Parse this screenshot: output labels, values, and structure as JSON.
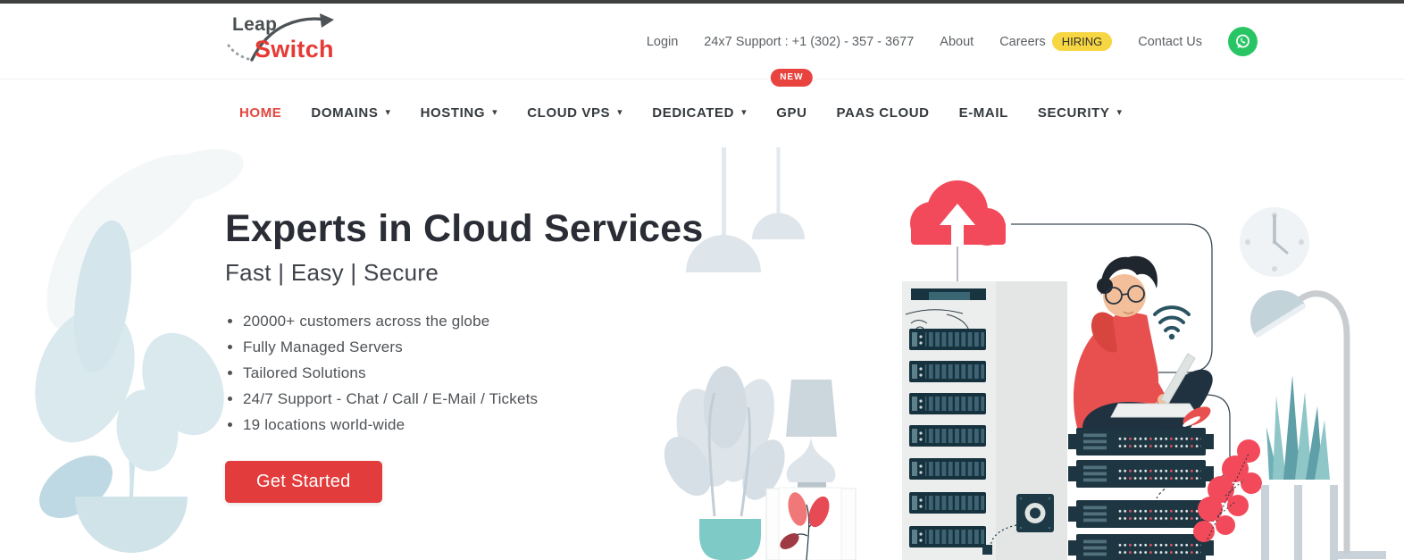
{
  "brand": {
    "line1": "Leap",
    "line2": "Switch"
  },
  "topbar": {
    "login": "Login",
    "support": "24x7 Support : +1 (302) - 357 - 3677",
    "about": "About",
    "careers": "Careers",
    "hiring_badge": "HIRING",
    "contact": "Contact Us"
  },
  "nav": {
    "new_badge": "NEW",
    "items": [
      {
        "label": "HOME",
        "active": true,
        "dropdown": false
      },
      {
        "label": "DOMAINS",
        "dropdown": true
      },
      {
        "label": "HOSTING",
        "dropdown": true
      },
      {
        "label": "CLOUD VPS",
        "dropdown": true
      },
      {
        "label": "DEDICATED",
        "dropdown": true
      },
      {
        "label": "GPU",
        "dropdown": false,
        "badge": "NEW"
      },
      {
        "label": "PAAS CLOUD",
        "dropdown": false
      },
      {
        "label": "E-MAIL",
        "dropdown": false
      },
      {
        "label": "SECURITY",
        "dropdown": true
      }
    ]
  },
  "hero": {
    "title": "Experts in Cloud Services",
    "subtitle": "Fast | Easy | Secure",
    "bullets": [
      "20000+ customers across the globe",
      "Fully Managed Servers",
      "Tailored Solutions",
      "24/7 Support - Chat / Call / E-Mail / Tickets",
      "19 locations world-wide"
    ],
    "cta": "Get Started"
  },
  "icons": {
    "chevron_down": "▾"
  },
  "colors": {
    "accent_red": "#e23c3c",
    "logo_red": "#e63a35",
    "badge_yellow": "#f6d643",
    "whatsapp_green": "#29c564",
    "heading": "#2a2d35",
    "cloud_red": "#f24a5a",
    "server_navy": "#1d3642",
    "pot_teal": "#7ecac7",
    "pale_blue": "#d9e9ee"
  }
}
